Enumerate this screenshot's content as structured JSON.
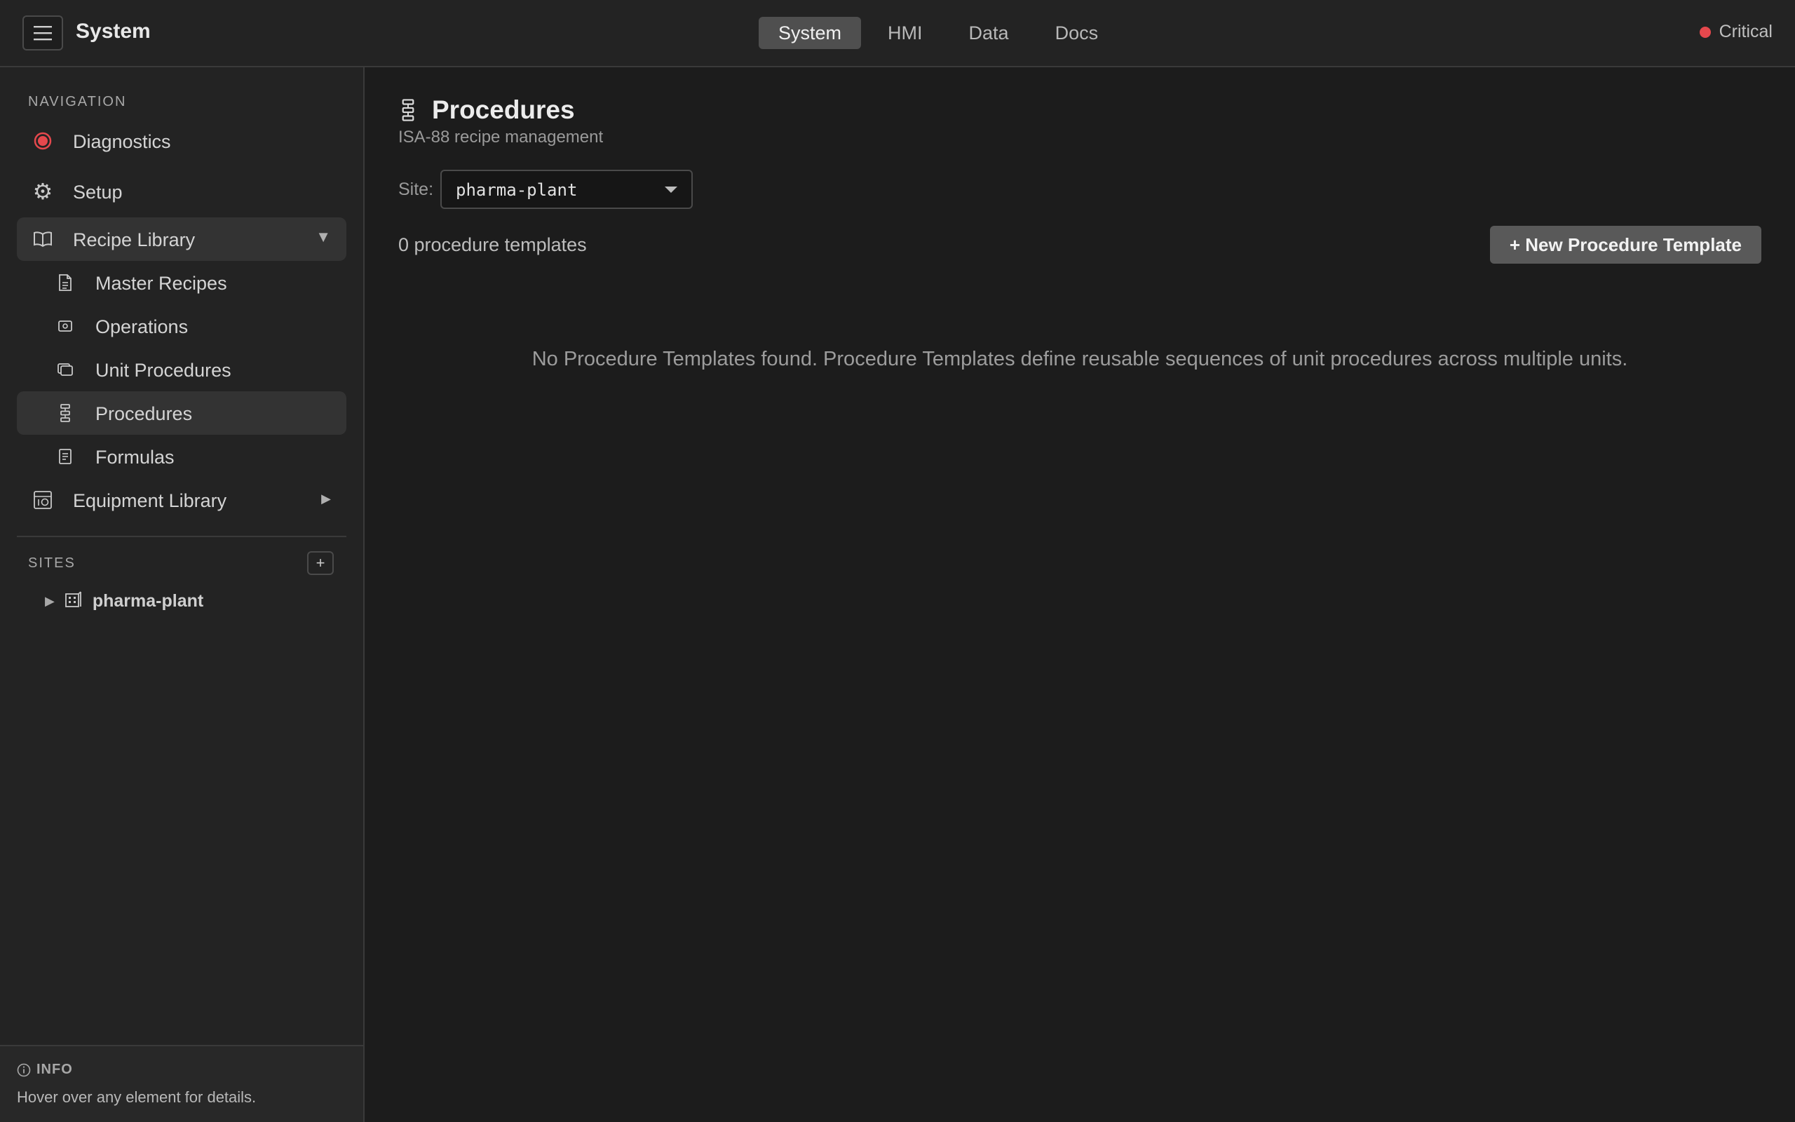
{
  "topbar": {
    "menu_icon": "hamburger-icon",
    "title": "System",
    "tabs": [
      {
        "label": "System",
        "active": true
      },
      {
        "label": "HMI",
        "active": false
      },
      {
        "label": "Data",
        "active": false
      },
      {
        "label": "Docs",
        "active": false
      }
    ],
    "status": {
      "label": "Critical",
      "color": "#e5484d"
    }
  },
  "sidebar": {
    "nav_label": "NAVIGATION",
    "items": [
      {
        "label": "Diagnostics",
        "icon": "diagnostics-icon"
      },
      {
        "label": "Setup",
        "icon": "gear-icon"
      },
      {
        "label": "Recipe Library",
        "icon": "book-icon",
        "expanded": true
      },
      {
        "label": "Master Recipes",
        "icon": "document-icon"
      },
      {
        "label": "Operations",
        "icon": "operation-icon"
      },
      {
        "label": "Unit Procedures",
        "icon": "layers-icon"
      },
      {
        "label": "Procedures",
        "icon": "procedure-icon",
        "selected": true
      },
      {
        "label": "Formulas",
        "icon": "formula-icon"
      },
      {
        "label": "Equipment Library",
        "icon": "equipment-icon",
        "expanded": false
      }
    ],
    "sites_label": "SITES",
    "add_site_label": "+",
    "sites": [
      {
        "label": "pharma-plant",
        "icon": "building-icon"
      }
    ],
    "info": {
      "title": "INFO",
      "text": "Hover over any element for details."
    }
  },
  "main": {
    "title": "Procedures",
    "subtitle": "ISA-88 recipe management",
    "site_label": "Site:",
    "site_value": "pharma-plant",
    "count_text": "0 procedure templates",
    "new_button": "+ New Procedure Template",
    "empty_message": "No Procedure Templates found. Procedure Templates define reusable sequences of unit procedures across multiple units."
  },
  "colors": {
    "accent_red": "#e5484d",
    "background": "#1c1c1c",
    "panel": "#232323",
    "button": "#595959"
  }
}
